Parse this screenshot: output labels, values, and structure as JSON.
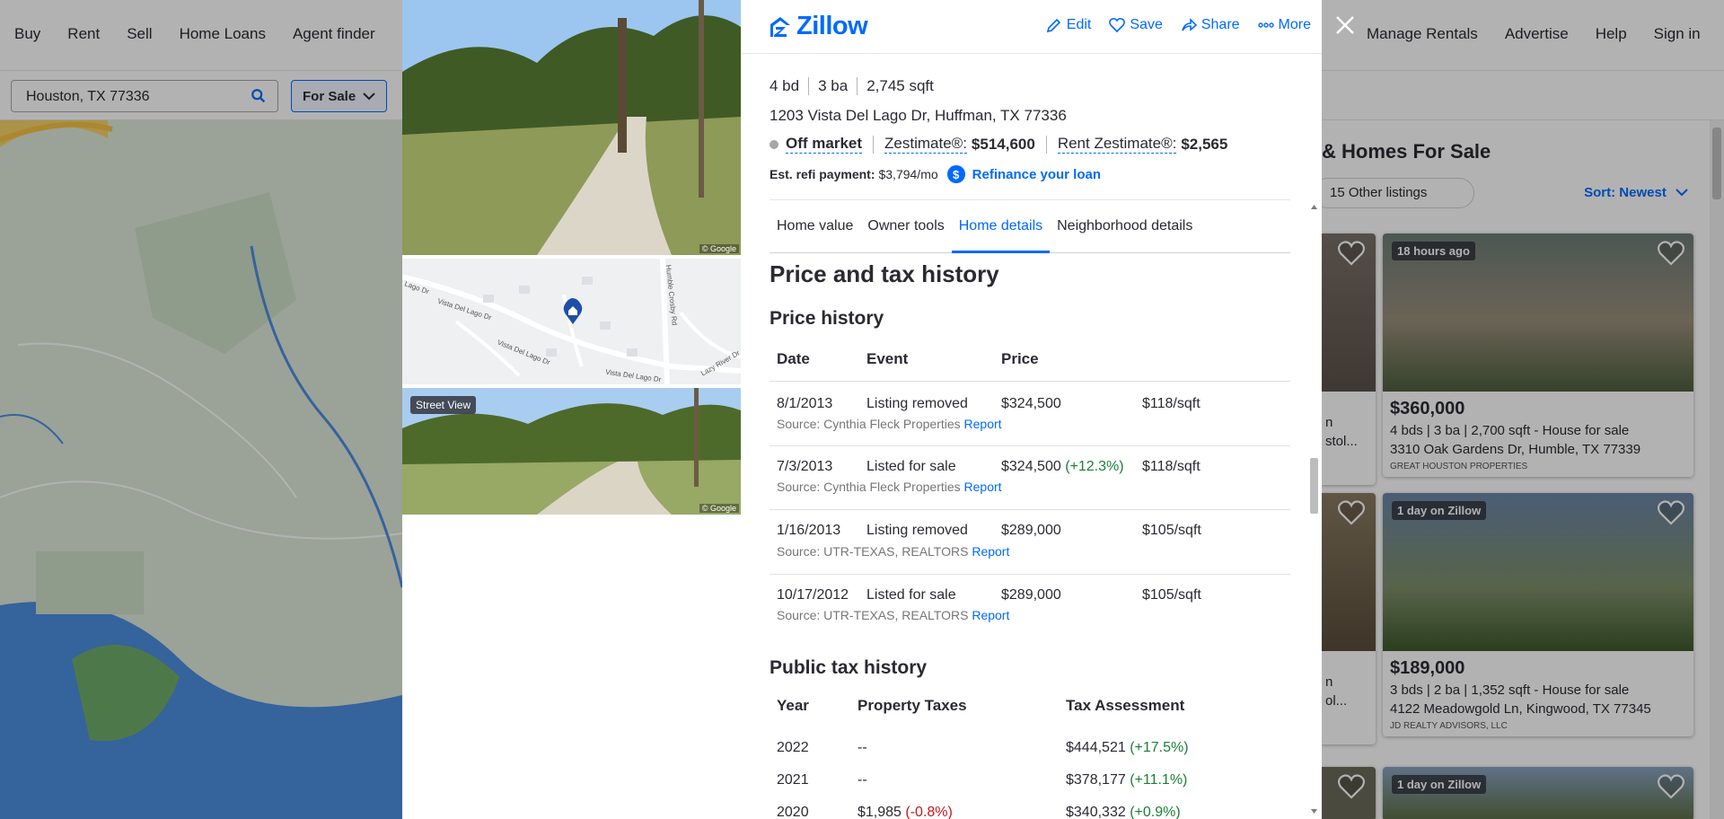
{
  "nav": {
    "left": [
      "Buy",
      "Rent",
      "Sell",
      "Home Loans",
      "Agent finder"
    ],
    "right": [
      "Manage Rentals",
      "Advertise",
      "Help",
      "Sign in"
    ]
  },
  "search": {
    "value": "Houston, TX 77336",
    "filter_label": "For Sale"
  },
  "results": {
    "title": "& Homes For Sale",
    "tab_label": "15 Other listings",
    "sort_label": "Sort: Newest",
    "cards": [
      {
        "badge": "18 hours ago",
        "price": "$360,000",
        "meta": "4 bds | 3 ba | 2,700 sqft - House for sale",
        "address": "3310 Oak Gardens Dr, Humble, TX 77339",
        "broker": "GREAT HOUSTON PROPERTIES"
      },
      {
        "badge": "1 day on Zillow",
        "price": "$189,000",
        "meta": "3 bds | 2 ba | 1,352 sqft - House for sale",
        "address": "4122 Meadowgold Ln, Kingwood, TX 77345",
        "broker": "JD REALTY ADVISORS, LLC"
      },
      {
        "badge": "1 day on Zillow"
      }
    ],
    "partial_texts": [
      "n",
      "stol...",
      "n",
      "ol..."
    ]
  },
  "header": {
    "logo": "Zillow",
    "actions": [
      "Edit",
      "Save",
      "Share",
      "More"
    ]
  },
  "gallery": {
    "street_view_label": "Street View",
    "google": "© Google",
    "map_streets": [
      "Vista Del Lago Dr",
      "Vista Del Lago Dr",
      "Vista Del Lago Dr",
      "Lago Dr",
      "Humble Crosby Rd",
      "Lazy River Dr"
    ]
  },
  "property": {
    "beds": "4 bd",
    "baths": "3 ba",
    "sqft": "2,745 sqft",
    "address": "1203 Vista Del Lago Dr, Huffman, TX 77336",
    "status": "Off market",
    "zestimate_label": "Zestimate®:",
    "zestimate_value": "$514,600",
    "rent_label": "Rent Zestimate®:",
    "rent_value": "$2,565",
    "refi_label": "Est. refi payment:",
    "refi_value": "$3,794/mo",
    "refi_link": "Refinance your loan"
  },
  "tabs": [
    "Home value",
    "Owner tools",
    "Home details",
    "Neighborhood details"
  ],
  "price_tax": {
    "title": "Price and tax history",
    "price_history_title": "Price history",
    "price_headers": [
      "Date",
      "Event",
      "Price"
    ],
    "price_rows": [
      {
        "date": "8/1/2013",
        "event": "Listing removed",
        "price": "$324,500",
        "change": "",
        "psf": "$118/sqft",
        "source": "Source: Cynthia Fleck Properties",
        "report": "Report"
      },
      {
        "date": "7/3/2013",
        "event": "Listed for sale",
        "price": "$324,500",
        "change": "(+12.3%)",
        "psf": "$118/sqft",
        "source": "Source: Cynthia Fleck Properties",
        "report": "Report"
      },
      {
        "date": "1/16/2013",
        "event": "Listing removed",
        "price": "$289,000",
        "change": "",
        "psf": "$105/sqft",
        "source": "Source: UTR-TEXAS, REALTORS",
        "report": "Report"
      },
      {
        "date": "10/17/2012",
        "event": "Listed for sale",
        "price": "$289,000",
        "change": "",
        "psf": "$105/sqft",
        "source": "Source: UTR-TEXAS, REALTORS",
        "report": "Report"
      }
    ],
    "tax_title": "Public tax history",
    "tax_headers": [
      "Year",
      "Property Taxes",
      "Tax Assessment"
    ],
    "tax_rows": [
      {
        "year": "2022",
        "taxes": "--",
        "tax_change": "",
        "assessment": "$444,521",
        "assess_change": "(+17.5%)"
      },
      {
        "year": "2021",
        "taxes": "--",
        "tax_change": "",
        "assessment": "$378,177",
        "assess_change": "(+11.1%)"
      },
      {
        "year": "2020",
        "taxes": "$1,985",
        "tax_change": "(-0.8%)",
        "assessment": "$340,332",
        "assess_change": "(+0.9%)"
      }
    ]
  }
}
